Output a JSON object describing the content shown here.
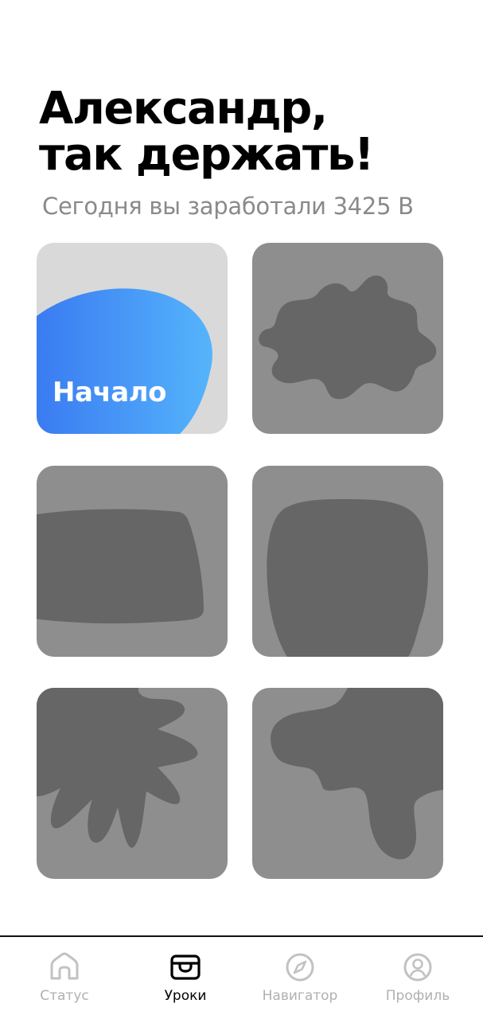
{
  "header": {
    "greeting_line1": "Александр,",
    "greeting_line2": "так держать!",
    "subtitle": "Сегодня вы заработали 3425 В"
  },
  "tiles": [
    {
      "label": "Начало",
      "shape": "blue-blob"
    },
    {
      "label": "",
      "shape": "splat"
    },
    {
      "label": "",
      "shape": "pillow"
    },
    {
      "label": "",
      "shape": "rounded-square"
    },
    {
      "label": "",
      "shape": "starburst"
    },
    {
      "label": "",
      "shape": "cloud"
    }
  ],
  "tabbar": {
    "items": [
      {
        "label": "Статус",
        "icon": "home-icon",
        "active": false
      },
      {
        "label": "Уроки",
        "icon": "inbox-icon",
        "active": true
      },
      {
        "label": "Навигатор",
        "icon": "compass-icon",
        "active": false
      },
      {
        "label": "Профиль",
        "icon": "profile-icon",
        "active": false
      }
    ]
  },
  "colors": {
    "tile_locked": "#8e8e8e",
    "shape_locked": "#666666",
    "tile_start_bg": "#d9d9d9",
    "accent_blue_start": "#3a7bf2",
    "accent_blue_end": "#55b4fb",
    "tab_inactive": "#b0b0b0",
    "tab_active": "#000000"
  }
}
